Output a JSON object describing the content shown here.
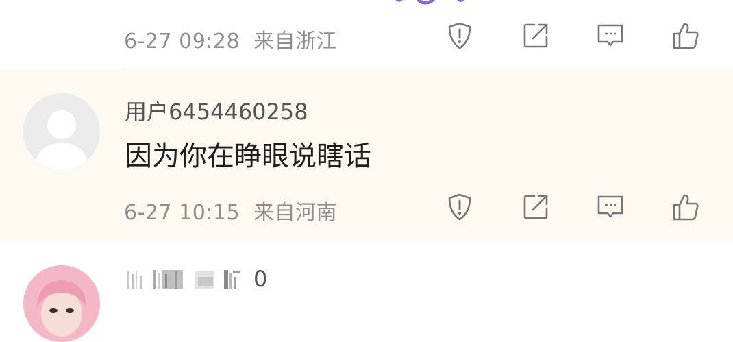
{
  "comments": [
    {
      "time": "6-27 09:28",
      "location": "来自浙江"
    },
    {
      "username": "用户6454460258",
      "text": "因为你在睁眼说瞎话",
      "time": "6-27 10:15",
      "location": "来自河南"
    },
    {
      "username_visible_suffix": "0"
    }
  ],
  "icons": {
    "report": "report-shield-icon",
    "forward": "forward-icon",
    "comment": "comment-icon",
    "like": "like-thumb-icon"
  },
  "colors": {
    "highlight_bg": "#fbf9f0",
    "meta_text": "#8e8e8e",
    "icon_stroke": "#777777"
  }
}
